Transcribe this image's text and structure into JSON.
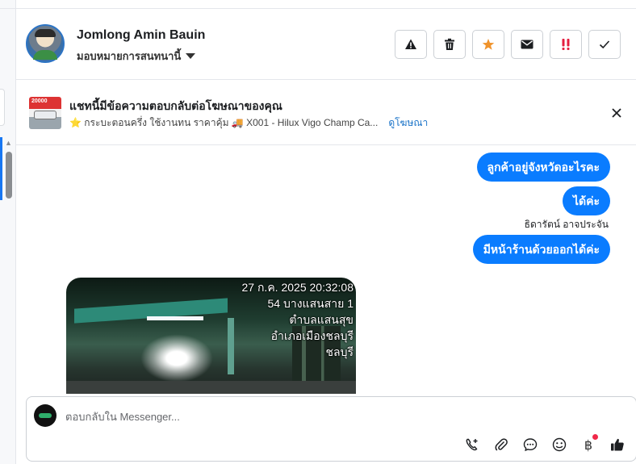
{
  "header": {
    "contact_name": "Jomlong Amin Bauin",
    "assign_label": "มอบหมายการสนทนานี้",
    "actions": [
      {
        "icon": "warning-icon",
        "color": "#1c1e21"
      },
      {
        "icon": "trash-icon",
        "color": "#1c1e21"
      },
      {
        "icon": "star-icon",
        "color": "#f0932b"
      },
      {
        "icon": "envelope-icon",
        "color": "#1c1e21"
      },
      {
        "icon": "double-exclamation-icon",
        "color": "#e41e3f"
      },
      {
        "icon": "checkmark-icon",
        "color": "#1c1e21"
      }
    ]
  },
  "ad_banner": {
    "thumb_price": "20000",
    "title": "แชทนี้มีข้อความตอบกลับต่อโฆษณาของคุณ",
    "description": "⭐ กระบะตอนครึ่ง ใช้งานทน ราคาคุ้ม 🚚 X001 - Hilux Vigo Champ Ca...",
    "view_ad_label": "ดูโฆษณา"
  },
  "messages": [
    {
      "text": "ลูกค้าอยู่จังหวัดอะไรคะ",
      "direction": "outgoing"
    },
    {
      "text": "ได้ค่ะ",
      "direction": "outgoing"
    },
    {
      "text": "มีหน้าร้านด้วยออกได้ค่ะ",
      "direction": "outgoing"
    }
  ],
  "sender_label": "ธิดารัตน์ อาจประจัน",
  "photo": {
    "timestamp_lines": [
      "27 ก.ค. 2025 20:32:08",
      "54 บางแสนสาย 1",
      "ตำบลแสนสุข",
      "อำเภอเมืองชลบุรี",
      "ชลบุรี"
    ]
  },
  "composer": {
    "placeholder": "ตอบกลับใน Messenger...",
    "tools": [
      "call-add-icon",
      "paperclip-icon",
      "chat-bubble-icon",
      "emoji-icon",
      "baht-icon",
      "thumbs-up-icon"
    ]
  },
  "colors": {
    "bubble_blue": "#0a7cff",
    "link_blue": "#1a73c8",
    "star_orange": "#f0932b",
    "alert_red": "#e41e3f"
  }
}
